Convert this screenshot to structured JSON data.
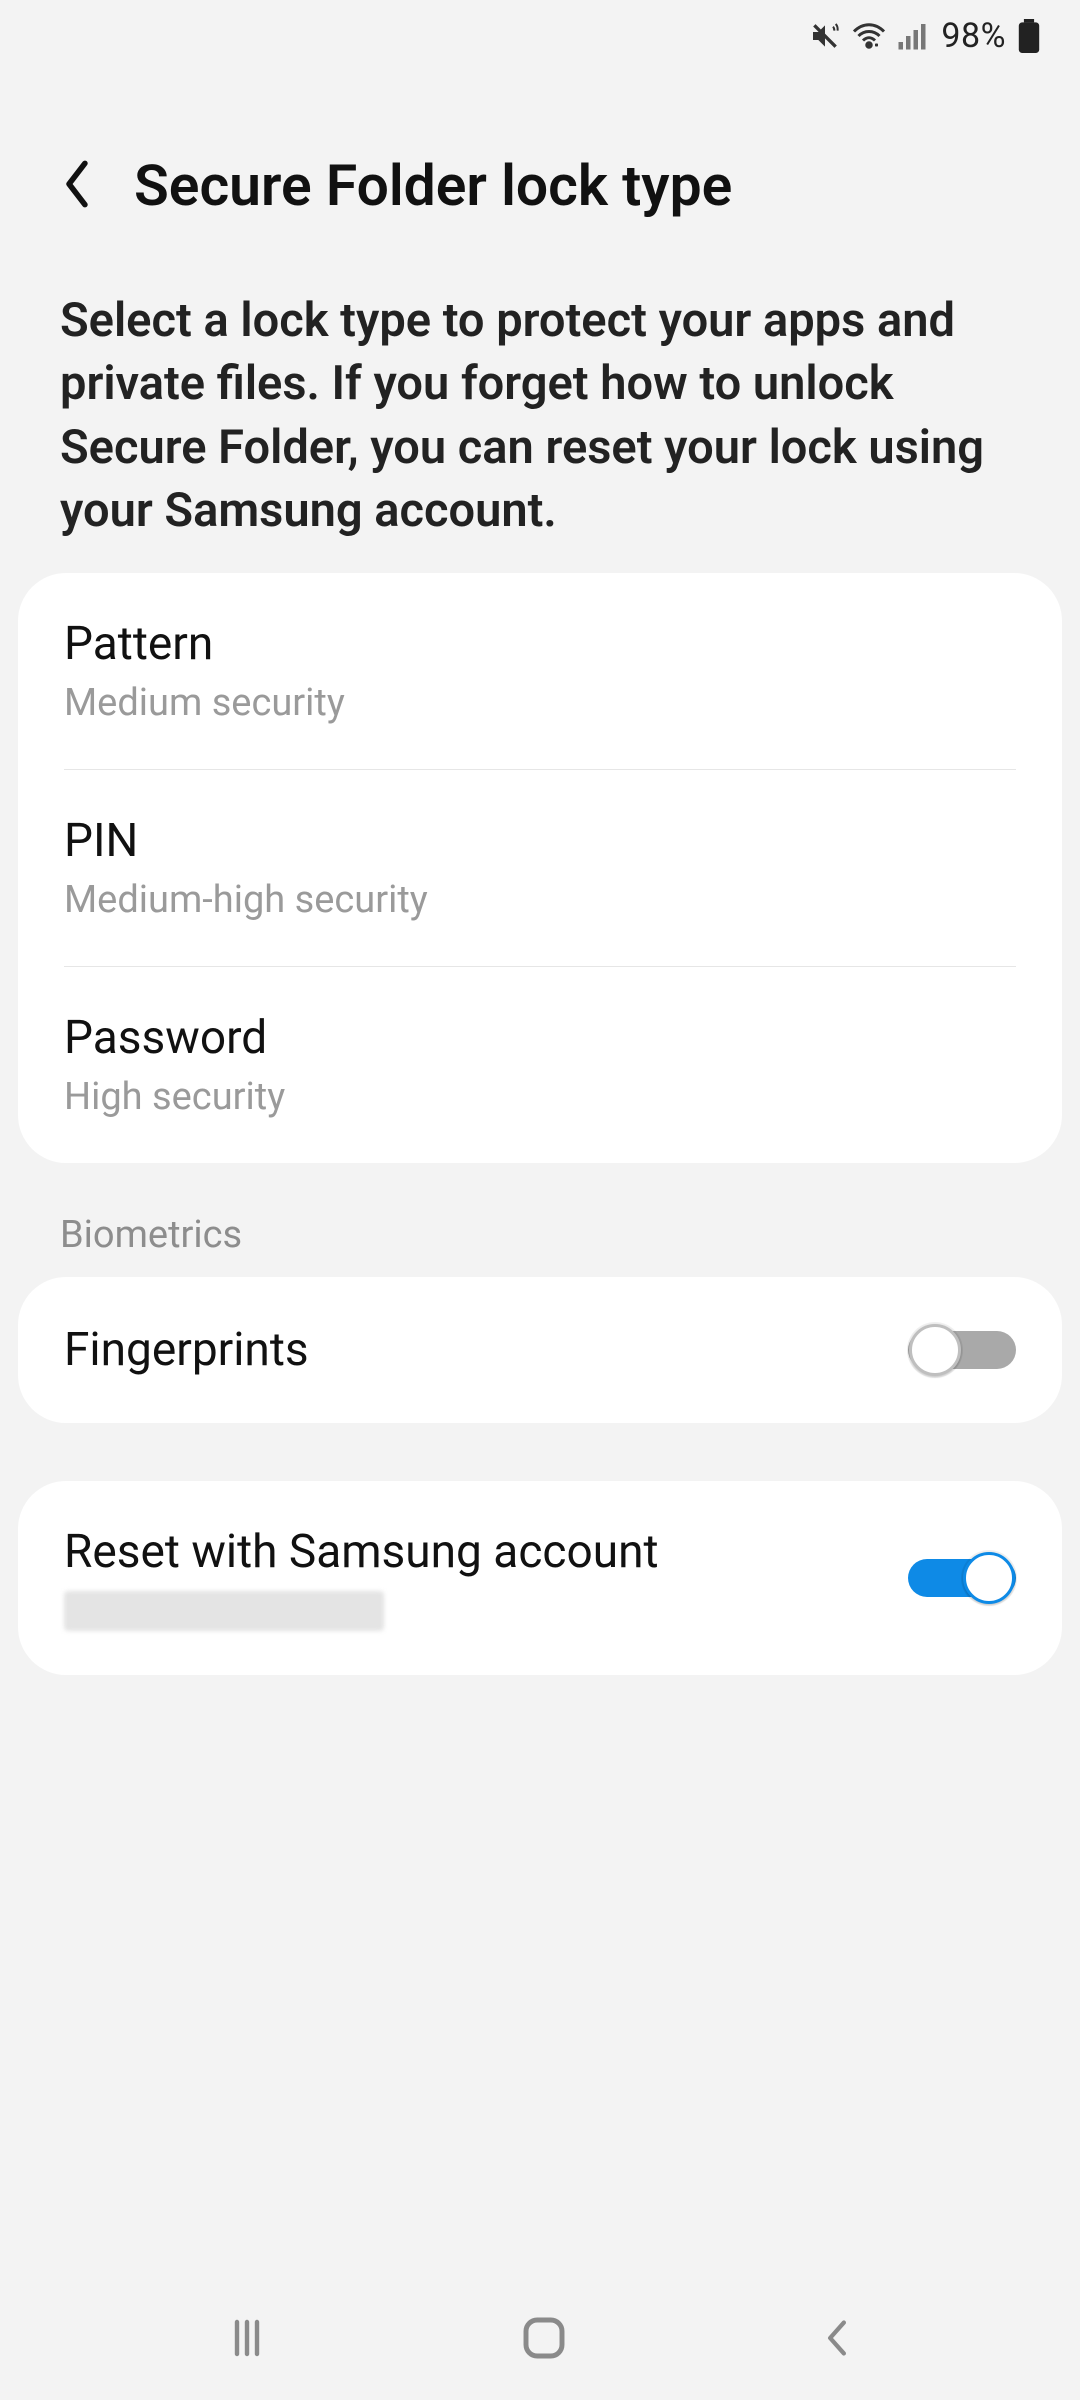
{
  "status": {
    "battery_percent": "98%"
  },
  "header": {
    "title": "Secure Folder lock type"
  },
  "description": "Select a lock type to protect your apps and private files. If you forget how to unlock Secure Folder, you can reset your lock using your Samsung account.",
  "lock_options": {
    "0": {
      "label": "Pattern",
      "sub": "Medium security"
    },
    "1": {
      "label": "PIN",
      "sub": "Medium-high security"
    },
    "2": {
      "label": "Password",
      "sub": "High security"
    }
  },
  "sections": {
    "biometrics_label": "Biometrics"
  },
  "biometrics": {
    "fingerprints": {
      "label": "Fingerprints",
      "on": false
    }
  },
  "reset": {
    "label": "Reset with Samsung account",
    "on": true
  }
}
